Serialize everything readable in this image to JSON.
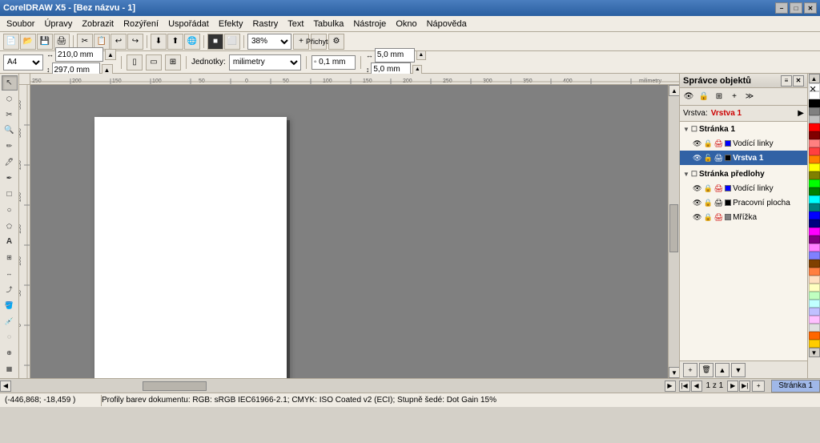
{
  "titlebar": {
    "title": "CorelDRAW X5 - [Bez názvu - 1]",
    "min": "−",
    "max": "□",
    "close": "✕"
  },
  "menubar": {
    "items": [
      "Soubor",
      "Úpravy",
      "Zobrazit",
      "Rozýření",
      "Uspořádat",
      "Efekty",
      "Rastry",
      "Text",
      "Tabulka",
      "Nástroje",
      "Okno",
      "Nápověda"
    ]
  },
  "toolbar1": {
    "buttons": [
      "📄",
      "📂",
      "💾",
      "🖨",
      "✂",
      "📋",
      "↩",
      "↪",
      "📐",
      "🔧"
    ]
  },
  "toolbar2": {
    "page_size": "A4",
    "width": "210,0 mm",
    "height": "297,0 mm",
    "zoom": "38%",
    "snap": "Přichytit",
    "units": "milimetry",
    "nudge": "◦ 0,1 mm",
    "nudge_x": "↔ 5,0 mm",
    "nudge_y": "↕ 5,0 mm"
  },
  "toolbox": {
    "tools": [
      "↖",
      "⬡",
      "□",
      "○",
      "✏",
      "🖊",
      "✒",
      "🪣",
      "🔤",
      "A",
      "⊞",
      "📏",
      "🔍",
      "🔗",
      "🤚",
      "✋"
    ]
  },
  "canvas": {
    "bg_color": "#808080"
  },
  "object_manager": {
    "title": "Správce objektů",
    "vrstva_label": "Vrstva:",
    "vrstva_value": "Vrstva 1",
    "layer_stranka1": "Stránka 1",
    "layer_vodici": "Vodící linky",
    "layer_vrstva1": "Vrstva 1",
    "layer_stranka_predlohy": "Stránka předlohy",
    "layer_vodici2": "Vodící linky",
    "layer_pracovni": "Pracovní plocha",
    "layer_mrizka": "Mřížka"
  },
  "page_tabs": {
    "nav": [
      "◀◀",
      "◀",
      "▶",
      "▶▶"
    ],
    "page_info": "1 z 1",
    "tab_name": "Stránka 1"
  },
  "status_bar": {
    "coords": "(-446,868; -18,459 )",
    "profile": "Profily barev dokumentu: RGB: sRGB IEC61966-2.1; CMYK: ISO Coated v2 (ECI); Stupně šedé: Dot Gain 15%"
  },
  "colors": {
    "accent": "#3162a5",
    "bg_light": "#f0ece4",
    "bg_mid": "#e8e4dc",
    "bg_dark": "#d4d0c8",
    "titlebar_start": "#4a7ebf",
    "titlebar_end": "#2a5fa0",
    "vrstva_red": "#cc0000",
    "page_tab_bg": "#c8d8f8",
    "palette_colors": [
      "#ffffff",
      "#000000",
      "#808080",
      "#c0c0c0",
      "#ff0000",
      "#800000",
      "#ff8080",
      "#ff4040",
      "#ff8000",
      "#ffff00",
      "#808000",
      "#00ff00",
      "#008000",
      "#00ffff",
      "#008080",
      "#0000ff",
      "#000080",
      "#ff00ff",
      "#800080",
      "#ff80ff",
      "#8080ff",
      "#804000",
      "#ff8040",
      "#ffe0c0",
      "#ffffc0",
      "#c0ffc0",
      "#c0ffff",
      "#c0c0ff",
      "#ffc0ff",
      "#e0e0e0",
      "#ff6600",
      "#ffcc00",
      "#ccff00",
      "#00ff66",
      "#00ccff",
      "#6600ff",
      "#ff0066",
      "#996633",
      "#669933",
      "#339966"
    ]
  }
}
